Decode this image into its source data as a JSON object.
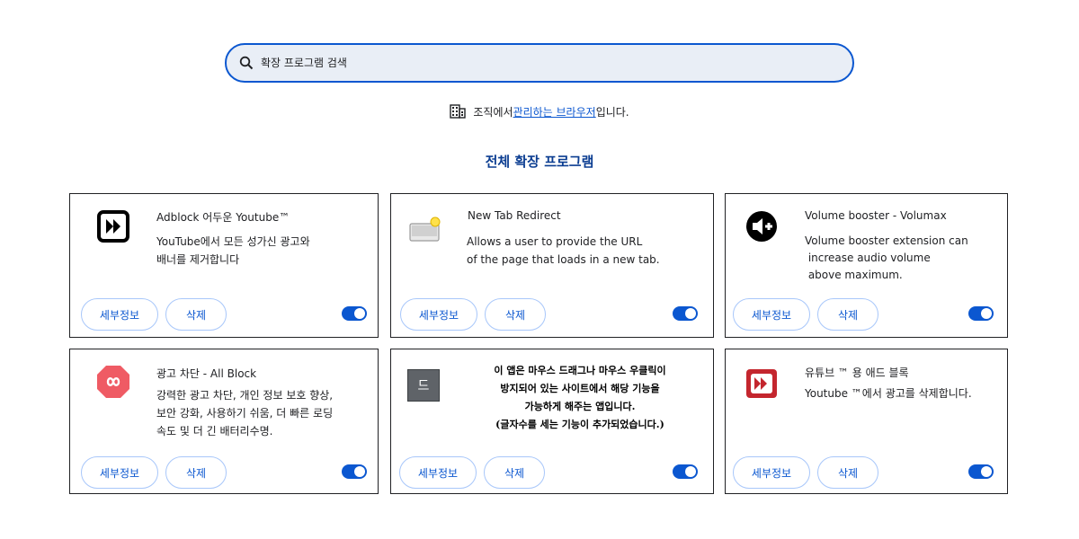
{
  "search": {
    "placeholder": "확장 프로그램 검색",
    "icon": "search-icon"
  },
  "managed": {
    "prefix": "조직에서 ",
    "link": "관리하는 브라우저",
    "suffix": "입니다."
  },
  "section_title": "전체 확장 프로그램",
  "buttons": {
    "details": "세부정보",
    "remove": "삭제"
  },
  "extensions": [
    {
      "name": "Adblock 어두운 Youtube™",
      "description": "YouTube에서 모든 성가신 광고와\n배너를 제거합니다",
      "enabled": true,
      "icon": "adblock-dark-icon"
    },
    {
      "name": "New Tab Redirect",
      "description": "Allows a user to provide the URL\nof the page that loads in a new tab.",
      "enabled": true,
      "icon": "new-tab-redirect-icon"
    },
    {
      "name": "Volume booster - Volumax",
      "description": "Volume booster extension can\n increase audio volume\n above maximum.",
      "enabled": true,
      "icon": "volume-booster-icon"
    },
    {
      "name": "광고 차단 - All Block",
      "description": "강력한 광고 차단, 개인 정보 보호 향상,\n보안 강화, 사용하기 쉬움, 더 빠른 로딩\n속도 및 더 긴 배터리수명.",
      "enabled": true,
      "icon": "all-block-icon"
    },
    {
      "name": "",
      "description": "이 앱은 마우스 드래그나 마우스 우클릭이\n방지되어 있는 사이트에서 해당 기능을\n가능하게 해주는 앱입니다.\n(글자수를 세는 기능이 추가되었습니다.)",
      "enabled": true,
      "icon": "drag-enable-icon",
      "icon_letter": "드"
    },
    {
      "name": "유튜브 ™ 용 애드 블록",
      "description": "Youtube ™에서 광고를 삭제합니다.",
      "enabled": true,
      "icon": "youtube-adblock-icon"
    }
  ],
  "colors": {
    "accent": "#0b57d0",
    "title": "#0b3d91",
    "all_block_red": "#ef5b64",
    "yt_red": "#c4262e"
  }
}
